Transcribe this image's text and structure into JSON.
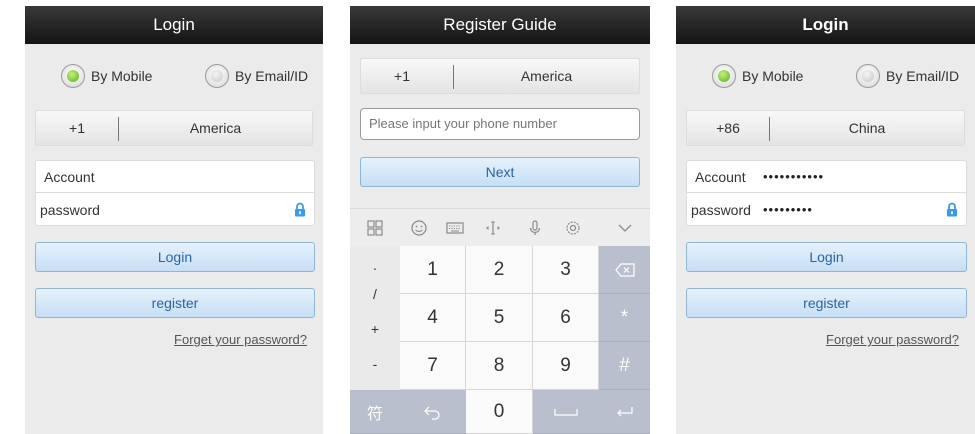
{
  "screen1": {
    "title": "Login",
    "radio_mobile": "By Mobile",
    "radio_email": "By Email/ID",
    "country_code": "+1",
    "country_name": "America",
    "account_label": "Account",
    "password_label": "password",
    "login_button": "Login",
    "register_button": "register",
    "forget_link": "Forget your password?"
  },
  "screen2": {
    "title": "Register Guide",
    "country_code": "+1",
    "country_name": "America",
    "phone_placeholder": "Please input your phone number",
    "next_button": "Next",
    "keyboard": {
      "symbols": [
        "·",
        "/",
        "+",
        "-"
      ],
      "keys": [
        [
          "1",
          "2",
          "3"
        ],
        [
          "4",
          "5",
          "6"
        ],
        [
          "7",
          "8",
          "9"
        ]
      ],
      "asterisk": "*",
      "hash": "#",
      "zero": "0",
      "fu": "符"
    }
  },
  "screen3": {
    "title": "Login",
    "radio_mobile": "By Mobile",
    "radio_email": "By Email/ID",
    "country_code": "+86",
    "country_name": "China",
    "account_label": "Account",
    "account_value": "•••••••••••",
    "password_label": "password",
    "password_value": "•••••••••",
    "login_button": "Login",
    "register_button": "register",
    "forget_link": "Forget your password?"
  },
  "colors": {
    "titlebar": "#141414",
    "button_text": "#2a64a8",
    "radio_selected": "#55b020",
    "lock": "#3a9be8"
  }
}
